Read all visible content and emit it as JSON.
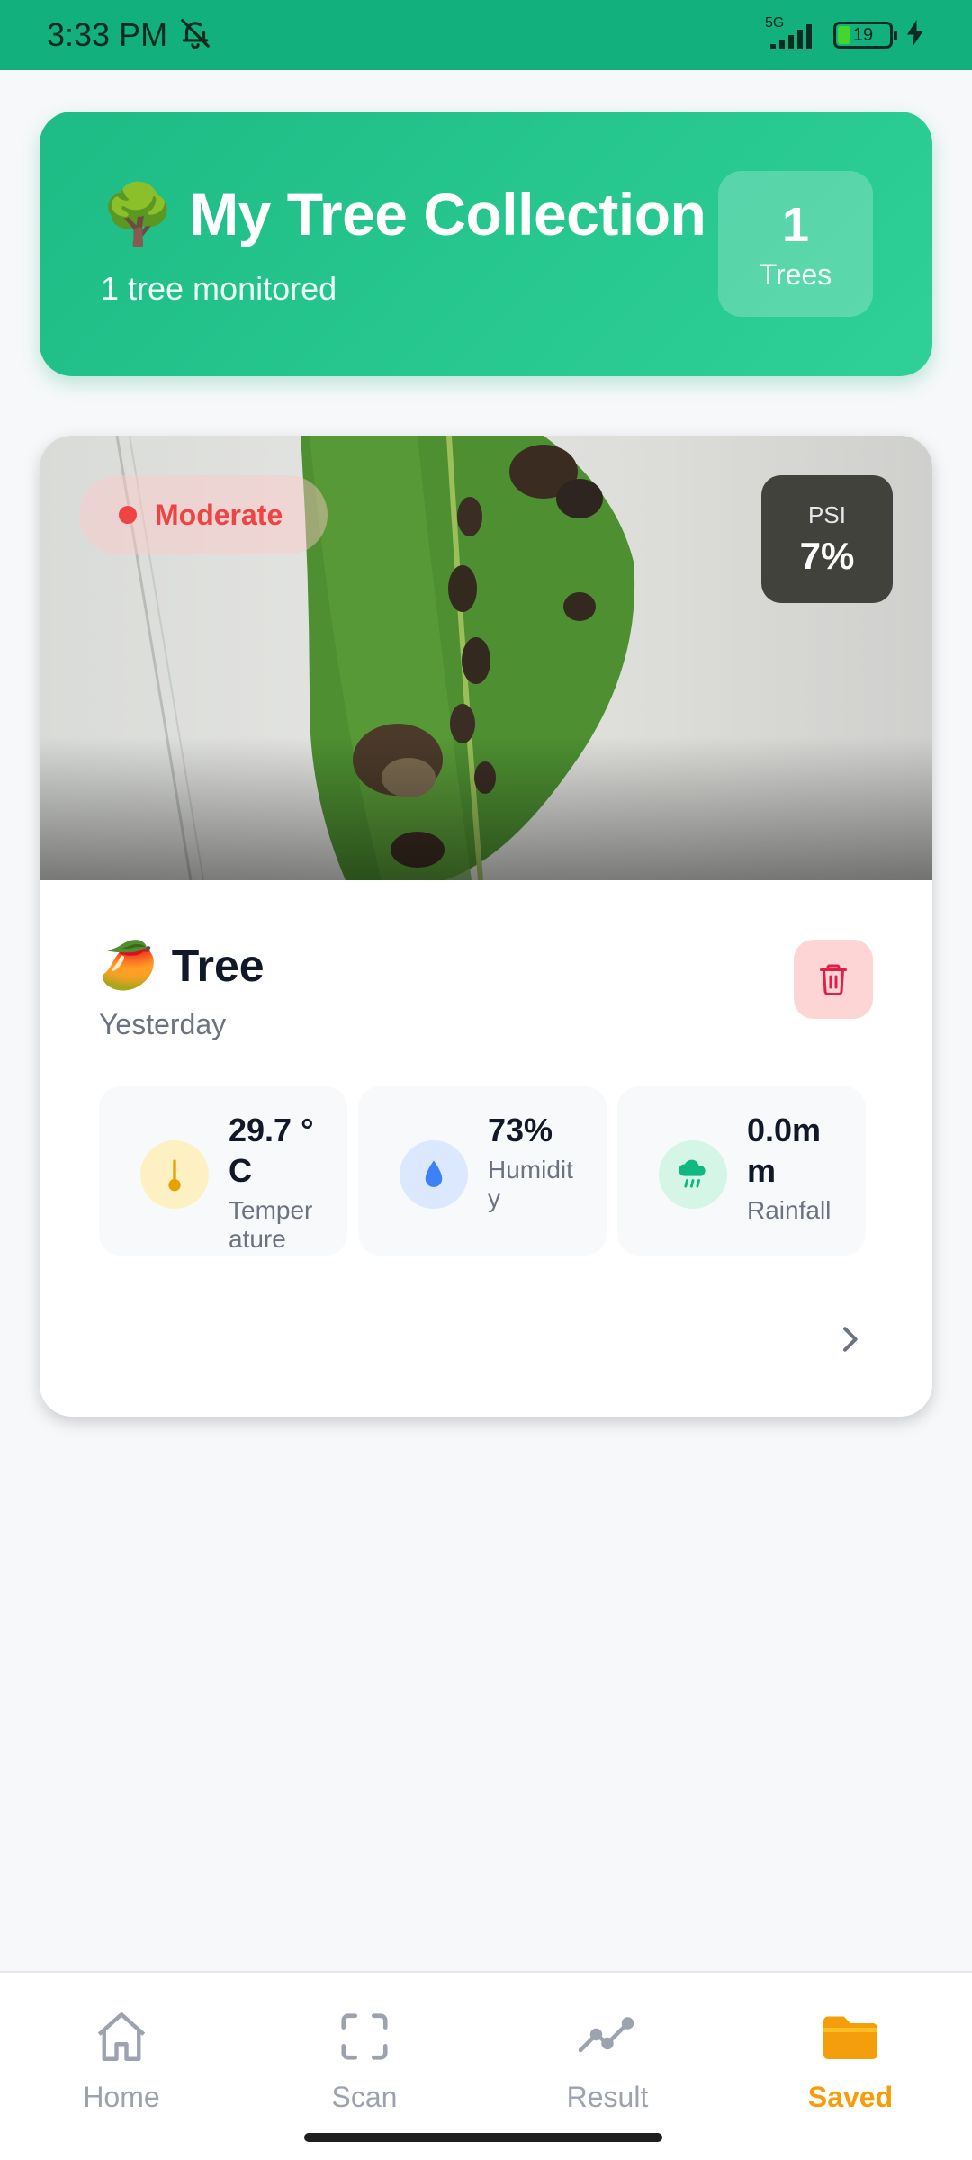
{
  "status_bar": {
    "time": "3:33 PM",
    "network": "5G",
    "battery": "19",
    "icons": [
      "bell-muted-icon",
      "signal-icon",
      "battery-icon",
      "charging-icon"
    ]
  },
  "header": {
    "emoji": "🌳",
    "title": "My Tree Collection",
    "subtitle": "1 tree monitored",
    "count_value": "1",
    "count_label": "Trees"
  },
  "tree_card": {
    "severity": "Moderate",
    "psi_label": "PSI",
    "psi_value": "7%",
    "emoji": "🥭",
    "name": "Tree",
    "date": "Yesterday",
    "stats": [
      {
        "value": "29.7 °C",
        "label": "Temperature",
        "icon": "thermometer-icon"
      },
      {
        "value": "73%",
        "label": "Humidity",
        "icon": "droplet-icon"
      },
      {
        "value": "0.0mm",
        "label": "Rainfall",
        "icon": "rain-cloud-icon"
      }
    ]
  },
  "nav": {
    "items": [
      {
        "label": "Home",
        "icon": "home-icon"
      },
      {
        "label": "Scan",
        "icon": "scan-icon"
      },
      {
        "label": "Result",
        "icon": "chart-line-icon"
      },
      {
        "label": "Saved",
        "icon": "folder-icon"
      }
    ],
    "active": "Saved"
  },
  "colors": {
    "brand": "#1dbb85",
    "active_nav": "#f59e0b",
    "severity": "#ef4444"
  }
}
